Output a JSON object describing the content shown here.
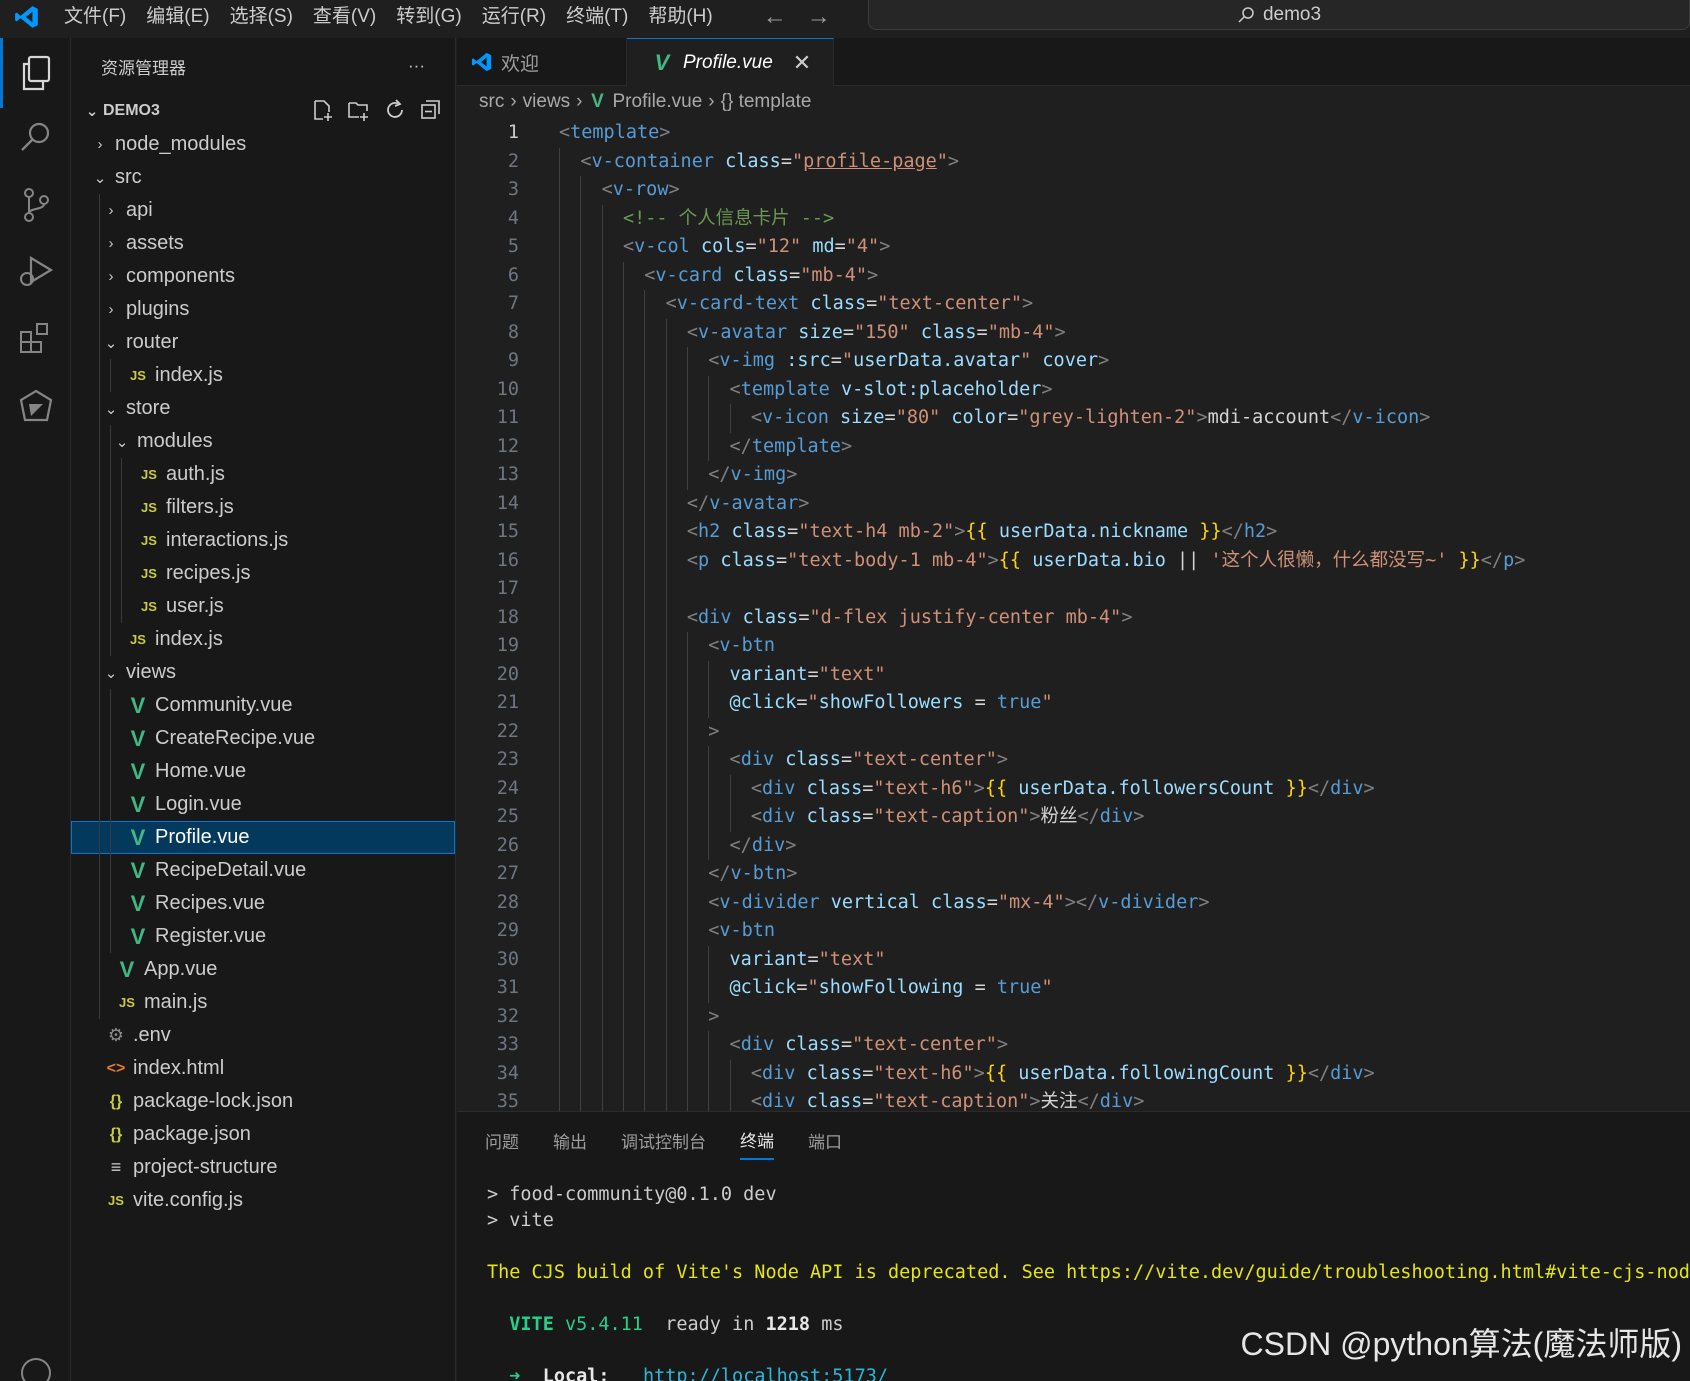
{
  "menu": [
    "文件(F)",
    "编辑(E)",
    "选择(S)",
    "查看(V)",
    "转到(G)",
    "运行(R)",
    "终端(T)",
    "帮助(H)"
  ],
  "search_box": "demo3",
  "sidebar": {
    "title": "资源管理器",
    "more": "···",
    "project": "DEMO3",
    "tree": [
      {
        "label": "node_modules",
        "depth": 0,
        "kind": "folder",
        "open": false
      },
      {
        "label": "src",
        "depth": 0,
        "kind": "folder",
        "open": true
      },
      {
        "label": "api",
        "depth": 1,
        "kind": "folder",
        "open": false
      },
      {
        "label": "assets",
        "depth": 1,
        "kind": "folder",
        "open": false
      },
      {
        "label": "components",
        "depth": 1,
        "kind": "folder",
        "open": false
      },
      {
        "label": "plugins",
        "depth": 1,
        "kind": "folder",
        "open": false
      },
      {
        "label": "router",
        "depth": 1,
        "kind": "folder",
        "open": true
      },
      {
        "label": "index.js",
        "depth": 2,
        "kind": "js"
      },
      {
        "label": "store",
        "depth": 1,
        "kind": "folder",
        "open": true
      },
      {
        "label": "modules",
        "depth": 2,
        "kind": "folder",
        "open": true
      },
      {
        "label": "auth.js",
        "depth": 3,
        "kind": "js"
      },
      {
        "label": "filters.js",
        "depth": 3,
        "kind": "js"
      },
      {
        "label": "interactions.js",
        "depth": 3,
        "kind": "js"
      },
      {
        "label": "recipes.js",
        "depth": 3,
        "kind": "js"
      },
      {
        "label": "user.js",
        "depth": 3,
        "kind": "js"
      },
      {
        "label": "index.js",
        "depth": 2,
        "kind": "js"
      },
      {
        "label": "views",
        "depth": 1,
        "kind": "folder",
        "open": true
      },
      {
        "label": "Community.vue",
        "depth": 2,
        "kind": "vue"
      },
      {
        "label": "CreateRecipe.vue",
        "depth": 2,
        "kind": "vue"
      },
      {
        "label": "Home.vue",
        "depth": 2,
        "kind": "vue"
      },
      {
        "label": "Login.vue",
        "depth": 2,
        "kind": "vue"
      },
      {
        "label": "Profile.vue",
        "depth": 2,
        "kind": "vue",
        "selected": true
      },
      {
        "label": "RecipeDetail.vue",
        "depth": 2,
        "kind": "vue"
      },
      {
        "label": "Recipes.vue",
        "depth": 2,
        "kind": "vue"
      },
      {
        "label": "Register.vue",
        "depth": 2,
        "kind": "vue"
      },
      {
        "label": "App.vue",
        "depth": 1,
        "kind": "vue"
      },
      {
        "label": "main.js",
        "depth": 1,
        "kind": "js"
      },
      {
        "label": ".env",
        "depth": 0,
        "kind": "gear"
      },
      {
        "label": "index.html",
        "depth": 0,
        "kind": "html"
      },
      {
        "label": "package-lock.json",
        "depth": 0,
        "kind": "json"
      },
      {
        "label": "package.json",
        "depth": 0,
        "kind": "json"
      },
      {
        "label": "project-structure",
        "depth": 0,
        "kind": "txt"
      },
      {
        "label": "vite.config.js",
        "depth": 0,
        "kind": "js"
      }
    ]
  },
  "tabs": [
    {
      "label": "欢迎",
      "active": false
    },
    {
      "label": "Profile.vue",
      "active": true,
      "close": "✕"
    }
  ],
  "breadcrumbs": [
    "src",
    "views",
    "Profile.vue",
    "{} template"
  ],
  "code": [
    {
      "n": 1,
      "i": 0,
      "s": [
        [
          "br",
          "<"
        ],
        [
          "tag",
          "template"
        ],
        [
          "br",
          ">"
        ]
      ]
    },
    {
      "n": 2,
      "i": 1,
      "s": [
        [
          "br",
          "<"
        ],
        [
          "tag",
          "v-container"
        ],
        [
          "txt",
          " "
        ],
        [
          "attr",
          "class"
        ],
        [
          "txt",
          "="
        ],
        [
          "str",
          "\""
        ],
        [
          "strul",
          "profile-page"
        ],
        [
          "str",
          "\""
        ],
        [
          "br",
          ">"
        ]
      ]
    },
    {
      "n": 3,
      "i": 2,
      "s": [
        [
          "br",
          "<"
        ],
        [
          "tag",
          "v-row"
        ],
        [
          "br",
          ">"
        ]
      ]
    },
    {
      "n": 4,
      "i": 3,
      "s": [
        [
          "com",
          "<!-- 个人信息卡片 -->"
        ]
      ]
    },
    {
      "n": 5,
      "i": 3,
      "s": [
        [
          "br",
          "<"
        ],
        [
          "tag",
          "v-col"
        ],
        [
          "txt",
          " "
        ],
        [
          "attr",
          "cols"
        ],
        [
          "txt",
          "="
        ],
        [
          "str",
          "\"12\""
        ],
        [
          "txt",
          " "
        ],
        [
          "attr",
          "md"
        ],
        [
          "txt",
          "="
        ],
        [
          "str",
          "\"4\""
        ],
        [
          "br",
          ">"
        ]
      ]
    },
    {
      "n": 6,
      "i": 4,
      "s": [
        [
          "br",
          "<"
        ],
        [
          "tag",
          "v-card"
        ],
        [
          "txt",
          " "
        ],
        [
          "attr",
          "class"
        ],
        [
          "txt",
          "="
        ],
        [
          "str",
          "\"mb-4\""
        ],
        [
          "br",
          ">"
        ]
      ]
    },
    {
      "n": 7,
      "i": 5,
      "s": [
        [
          "br",
          "<"
        ],
        [
          "tag",
          "v-card-text"
        ],
        [
          "txt",
          " "
        ],
        [
          "attr",
          "class"
        ],
        [
          "txt",
          "="
        ],
        [
          "str",
          "\"text-center\""
        ],
        [
          "br",
          ">"
        ]
      ]
    },
    {
      "n": 8,
      "i": 6,
      "s": [
        [
          "br",
          "<"
        ],
        [
          "tag",
          "v-avatar"
        ],
        [
          "txt",
          " "
        ],
        [
          "attr",
          "size"
        ],
        [
          "txt",
          "="
        ],
        [
          "str",
          "\"150\""
        ],
        [
          "txt",
          " "
        ],
        [
          "attr",
          "class"
        ],
        [
          "txt",
          "="
        ],
        [
          "str",
          "\"mb-4\""
        ],
        [
          "br",
          ">"
        ]
      ]
    },
    {
      "n": 9,
      "i": 7,
      "s": [
        [
          "br",
          "<"
        ],
        [
          "tag",
          "v-img"
        ],
        [
          "txt",
          " "
        ],
        [
          "attr",
          ":src"
        ],
        [
          "txt",
          "="
        ],
        [
          "str",
          "\""
        ],
        [
          "attr",
          "userData.avatar"
        ],
        [
          "str",
          "\""
        ],
        [
          "txt",
          " "
        ],
        [
          "attr",
          "cover"
        ],
        [
          "br",
          ">"
        ]
      ]
    },
    {
      "n": 10,
      "i": 8,
      "s": [
        [
          "br",
          "<"
        ],
        [
          "tag",
          "template"
        ],
        [
          "txt",
          " "
        ],
        [
          "attr",
          "v-slot:placeholder"
        ],
        [
          "br",
          ">"
        ]
      ]
    },
    {
      "n": 11,
      "i": 9,
      "s": [
        [
          "br",
          "<"
        ],
        [
          "tag",
          "v-icon"
        ],
        [
          "txt",
          " "
        ],
        [
          "attr",
          "size"
        ],
        [
          "txt",
          "="
        ],
        [
          "str",
          "\"80\""
        ],
        [
          "txt",
          " "
        ],
        [
          "attr",
          "color"
        ],
        [
          "txt",
          "="
        ],
        [
          "str",
          "\"grey-lighten-2\""
        ],
        [
          "br",
          ">"
        ],
        [
          "txt",
          "mdi-account"
        ],
        [
          "br",
          "</"
        ],
        [
          "tag",
          "v-icon"
        ],
        [
          "br",
          ">"
        ]
      ]
    },
    {
      "n": 12,
      "i": 8,
      "s": [
        [
          "br",
          "</"
        ],
        [
          "tag",
          "template"
        ],
        [
          "br",
          ">"
        ]
      ]
    },
    {
      "n": 13,
      "i": 7,
      "s": [
        [
          "br",
          "</"
        ],
        [
          "tag",
          "v-img"
        ],
        [
          "br",
          ">"
        ]
      ]
    },
    {
      "n": 14,
      "i": 6,
      "s": [
        [
          "br",
          "</"
        ],
        [
          "tag",
          "v-avatar"
        ],
        [
          "br",
          ">"
        ]
      ]
    },
    {
      "n": 15,
      "i": 6,
      "s": [
        [
          "br",
          "<"
        ],
        [
          "tag",
          "h2"
        ],
        [
          "txt",
          " "
        ],
        [
          "attr",
          "class"
        ],
        [
          "txt",
          "="
        ],
        [
          "str",
          "\"text-h4 mb-2\""
        ],
        [
          "br",
          ">"
        ],
        [
          "brace",
          "{{"
        ],
        [
          "txt",
          " "
        ],
        [
          "attr",
          "userData.nickname"
        ],
        [
          "txt",
          " "
        ],
        [
          "brace",
          "}}"
        ],
        [
          "br",
          "</"
        ],
        [
          "tag",
          "h2"
        ],
        [
          "br",
          ">"
        ]
      ]
    },
    {
      "n": 16,
      "i": 6,
      "s": [
        [
          "br",
          "<"
        ],
        [
          "tag",
          "p"
        ],
        [
          "txt",
          " "
        ],
        [
          "attr",
          "class"
        ],
        [
          "txt",
          "="
        ],
        [
          "str",
          "\"text-body-1 mb-4\""
        ],
        [
          "br",
          ">"
        ],
        [
          "brace",
          "{{"
        ],
        [
          "txt",
          " "
        ],
        [
          "attr",
          "userData.bio"
        ],
        [
          "txt",
          " || "
        ],
        [
          "str",
          "'这个人很懒，什么都没写~'"
        ],
        [
          "txt",
          " "
        ],
        [
          "brace",
          "}}"
        ],
        [
          "br",
          "</"
        ],
        [
          "tag",
          "p"
        ],
        [
          "br",
          ">"
        ]
      ]
    },
    {
      "n": 17,
      "i": 6,
      "s": []
    },
    {
      "n": 18,
      "i": 6,
      "s": [
        [
          "br",
          "<"
        ],
        [
          "tag",
          "div"
        ],
        [
          "txt",
          " "
        ],
        [
          "attr",
          "class"
        ],
        [
          "txt",
          "="
        ],
        [
          "str",
          "\"d-flex justify-center mb-4\""
        ],
        [
          "br",
          ">"
        ]
      ]
    },
    {
      "n": 19,
      "i": 7,
      "s": [
        [
          "br",
          "<"
        ],
        [
          "tag",
          "v-btn"
        ]
      ]
    },
    {
      "n": 20,
      "i": 8,
      "s": [
        [
          "attr",
          "variant"
        ],
        [
          "txt",
          "="
        ],
        [
          "str",
          "\"text\""
        ]
      ]
    },
    {
      "n": 21,
      "i": 8,
      "s": [
        [
          "attr",
          "@click"
        ],
        [
          "txt",
          "="
        ],
        [
          "str",
          "\""
        ],
        [
          "attr",
          "showFollowers"
        ],
        [
          "txt",
          " = "
        ],
        [
          "tag",
          "true"
        ],
        [
          "str",
          "\""
        ]
      ]
    },
    {
      "n": 22,
      "i": 7,
      "s": [
        [
          "br",
          ">"
        ]
      ]
    },
    {
      "n": 23,
      "i": 8,
      "s": [
        [
          "br",
          "<"
        ],
        [
          "tag",
          "div"
        ],
        [
          "txt",
          " "
        ],
        [
          "attr",
          "class"
        ],
        [
          "txt",
          "="
        ],
        [
          "str",
          "\"text-center\""
        ],
        [
          "br",
          ">"
        ]
      ]
    },
    {
      "n": 24,
      "i": 9,
      "s": [
        [
          "br",
          "<"
        ],
        [
          "tag",
          "div"
        ],
        [
          "txt",
          " "
        ],
        [
          "attr",
          "class"
        ],
        [
          "txt",
          "="
        ],
        [
          "str",
          "\"text-h6\""
        ],
        [
          "br",
          ">"
        ],
        [
          "brace",
          "{{"
        ],
        [
          "txt",
          " "
        ],
        [
          "attr",
          "userData.followersCount"
        ],
        [
          "txt",
          " "
        ],
        [
          "brace",
          "}}"
        ],
        [
          "br",
          "</"
        ],
        [
          "tag",
          "div"
        ],
        [
          "br",
          ">"
        ]
      ]
    },
    {
      "n": 25,
      "i": 9,
      "s": [
        [
          "br",
          "<"
        ],
        [
          "tag",
          "div"
        ],
        [
          "txt",
          " "
        ],
        [
          "attr",
          "class"
        ],
        [
          "txt",
          "="
        ],
        [
          "str",
          "\"text-caption\""
        ],
        [
          "br",
          ">"
        ],
        [
          "txt",
          "粉丝"
        ],
        [
          "br",
          "</"
        ],
        [
          "tag",
          "div"
        ],
        [
          "br",
          ">"
        ]
      ]
    },
    {
      "n": 26,
      "i": 8,
      "s": [
        [
          "br",
          "</"
        ],
        [
          "tag",
          "div"
        ],
        [
          "br",
          ">"
        ]
      ]
    },
    {
      "n": 27,
      "i": 7,
      "s": [
        [
          "br",
          "</"
        ],
        [
          "tag",
          "v-btn"
        ],
        [
          "br",
          ">"
        ]
      ]
    },
    {
      "n": 28,
      "i": 7,
      "s": [
        [
          "br",
          "<"
        ],
        [
          "tag",
          "v-divider"
        ],
        [
          "txt",
          " "
        ],
        [
          "attr",
          "vertical"
        ],
        [
          "txt",
          " "
        ],
        [
          "attr",
          "class"
        ],
        [
          "txt",
          "="
        ],
        [
          "str",
          "\"mx-4\""
        ],
        [
          "br",
          "></"
        ],
        [
          "tag",
          "v-divider"
        ],
        [
          "br",
          ">"
        ]
      ]
    },
    {
      "n": 29,
      "i": 7,
      "s": [
        [
          "br",
          "<"
        ],
        [
          "tag",
          "v-btn"
        ]
      ]
    },
    {
      "n": 30,
      "i": 8,
      "s": [
        [
          "attr",
          "variant"
        ],
        [
          "txt",
          "="
        ],
        [
          "str",
          "\"text\""
        ]
      ]
    },
    {
      "n": 31,
      "i": 8,
      "s": [
        [
          "attr",
          "@click"
        ],
        [
          "txt",
          "="
        ],
        [
          "str",
          "\""
        ],
        [
          "attr",
          "showFollowing"
        ],
        [
          "txt",
          " = "
        ],
        [
          "tag",
          "true"
        ],
        [
          "str",
          "\""
        ]
      ]
    },
    {
      "n": 32,
      "i": 7,
      "s": [
        [
          "br",
          ">"
        ]
      ]
    },
    {
      "n": 33,
      "i": 8,
      "s": [
        [
          "br",
          "<"
        ],
        [
          "tag",
          "div"
        ],
        [
          "txt",
          " "
        ],
        [
          "attr",
          "class"
        ],
        [
          "txt",
          "="
        ],
        [
          "str",
          "\"text-center\""
        ],
        [
          "br",
          ">"
        ]
      ]
    },
    {
      "n": 34,
      "i": 9,
      "s": [
        [
          "br",
          "<"
        ],
        [
          "tag",
          "div"
        ],
        [
          "txt",
          " "
        ],
        [
          "attr",
          "class"
        ],
        [
          "txt",
          "="
        ],
        [
          "str",
          "\"text-h6\""
        ],
        [
          "br",
          ">"
        ],
        [
          "brace",
          "{{"
        ],
        [
          "txt",
          " "
        ],
        [
          "attr",
          "userData.followingCount"
        ],
        [
          "txt",
          " "
        ],
        [
          "brace",
          "}}"
        ],
        [
          "br",
          "</"
        ],
        [
          "tag",
          "div"
        ],
        [
          "br",
          ">"
        ]
      ]
    },
    {
      "n": 35,
      "i": 9,
      "s": [
        [
          "br",
          "<"
        ],
        [
          "tag",
          "div"
        ],
        [
          "txt",
          " "
        ],
        [
          "attr",
          "class"
        ],
        [
          "txt",
          "="
        ],
        [
          "str",
          "\"text-caption\""
        ],
        [
          "br",
          ">"
        ],
        [
          "txt",
          "关注"
        ],
        [
          "br",
          "</"
        ],
        [
          "tag",
          "div"
        ],
        [
          "br",
          ">"
        ]
      ]
    }
  ],
  "panel": {
    "tabs": [
      "问题",
      "输出",
      "调试控制台",
      "终端",
      "端口"
    ],
    "active_tab": "终端",
    "terminal": {
      "line1": "> food-community@0.1.0 dev",
      "line2": "> vite",
      "warning": "The CJS build of Vite's Node API is deprecated. See https://vite.dev/guide/troubleshooting.html#vite-cjs-node-api-deprecated for more details.",
      "vite_label": "VITE",
      "vite_version": "v5.4.11",
      "ready_text": "ready in",
      "ready_ms": "1218",
      "ms": "ms",
      "local_arrow": "➜",
      "local_label": "Local:",
      "local_url": "http://localhost:5173/"
    }
  },
  "watermark": "CSDN @python算法(魔法师版)",
  "colors": {
    "accent": "#0078d4",
    "selection": "#04395e",
    "vue": "#41b883",
    "js": "#cbcb41"
  }
}
